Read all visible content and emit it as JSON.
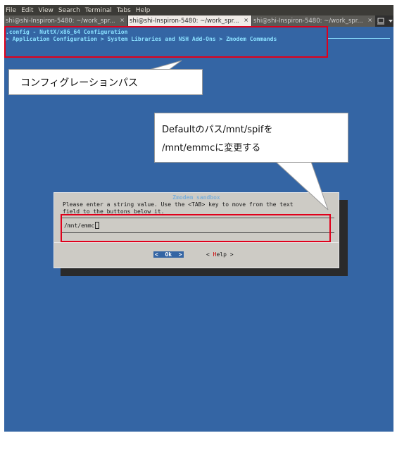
{
  "menubar": {
    "items": [
      "File",
      "Edit",
      "View",
      "Search",
      "Terminal",
      "Tabs",
      "Help"
    ]
  },
  "tabs": [
    {
      "label": "shi@shi-Inspiron-5480: ~/work_spr...",
      "close": "×",
      "active": false
    },
    {
      "label": "shi@shi-Inspiron-5480: ~/work_spr...",
      "close": "×",
      "active": true
    },
    {
      "label": "shi@shi-Inspiron-5480: ~/work_spr...",
      "close": "×",
      "active": false
    }
  ],
  "terminal": {
    "line1": ".config - NuttX/x86_64 Configuration",
    "line2": "> Application Configuration > System Libraries and NSH Add-Ons > Zmodem Commands"
  },
  "dialog": {
    "title": "Zmodem sandbox",
    "text1": "Please enter a string value. Use the <TAB> key to move from the text",
    "text2": "field to the buttons below it.",
    "input_value": "/mnt/emmc",
    "ok_label": "<  Ok  >",
    "help_prefix": "< ",
    "help_hot": "H",
    "help_rest": "elp >"
  },
  "callouts": {
    "path_label": "コンフィグレーションパス",
    "change_line1": "Defaultのパス/mnt/spifを",
    "change_line2": "/mnt/emmcに変更する"
  },
  "colors": {
    "terminal_bg": "#3465a4",
    "highlight": "#e0001b"
  }
}
